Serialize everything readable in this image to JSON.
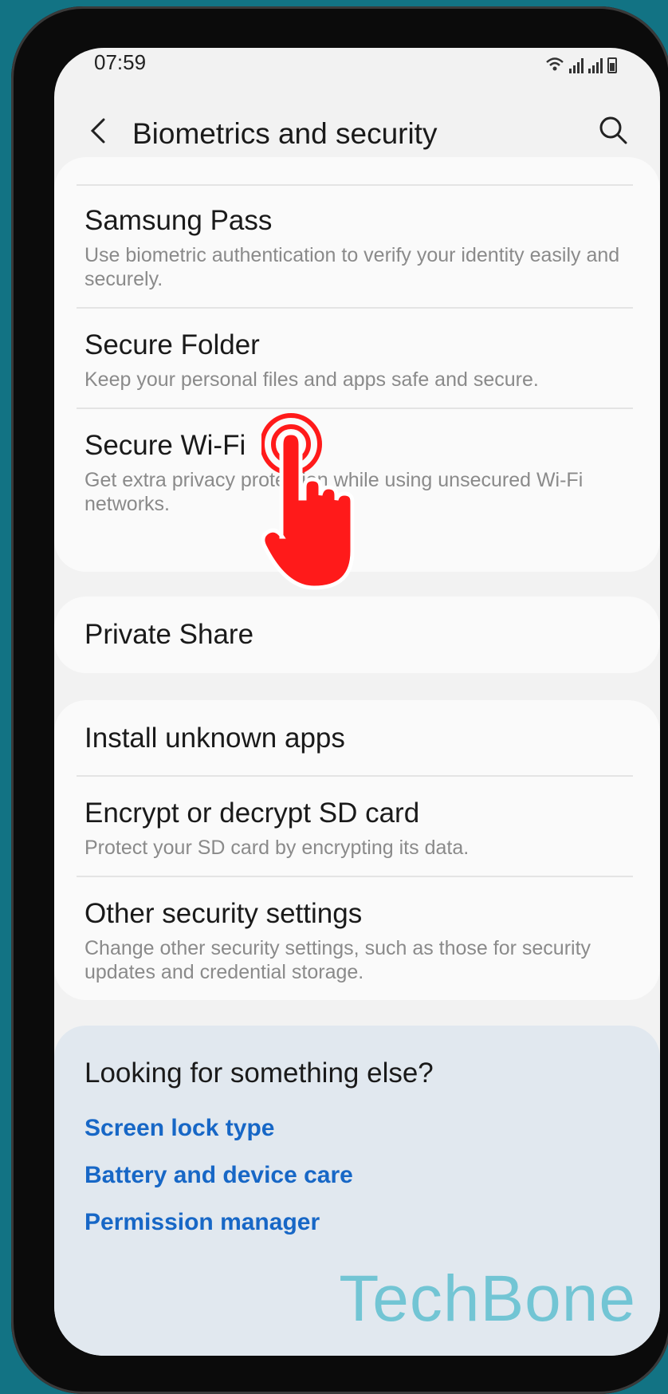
{
  "status_bar": {
    "time": "07:59"
  },
  "header": {
    "title": "Biometrics and security",
    "back_icon": "chevron-left-icon",
    "search_icon": "search-icon"
  },
  "sections": [
    {
      "items": [
        {
          "title": "Samsung Pass",
          "description": "Use biometric authentication to verify your identity easily and securely."
        },
        {
          "title": "Secure Folder",
          "description": "Keep your personal files and apps safe and secure."
        },
        {
          "title": "Secure Wi-Fi",
          "description": "Get extra privacy protection while using unsecured Wi-Fi networks."
        }
      ]
    },
    {
      "items": [
        {
          "title": "Private Share"
        }
      ]
    },
    {
      "items": [
        {
          "title": "Install unknown apps"
        },
        {
          "title": "Encrypt or decrypt SD card",
          "description": "Protect your SD card by encrypting its data."
        },
        {
          "title": "Other security settings",
          "description": "Change other security settings, such as those for security updates and credential storage."
        }
      ]
    }
  ],
  "suggestions": {
    "title": "Looking for something else?",
    "links": [
      "Screen lock type",
      "Battery and device care",
      "Permission manager"
    ]
  },
  "watermark": "TechBone",
  "colors": {
    "background": "#127384",
    "link": "#1767c6",
    "tap_indicator": "#ff1a1a"
  }
}
